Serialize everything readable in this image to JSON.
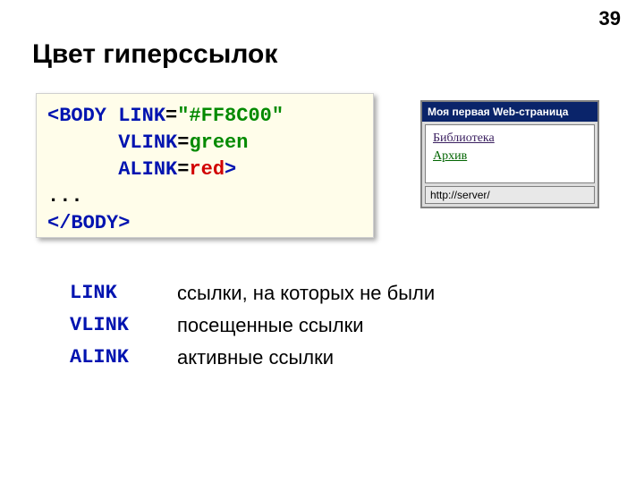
{
  "page_number": "39",
  "title": "Цвет гиперссылок",
  "code": {
    "tag_open": "<BODY",
    "attr_link": " LINK",
    "eq1": "=",
    "val_link": "\"#FF8C00\"",
    "indent": "      ",
    "attr_vlink": "VLINK",
    "eq2": "=",
    "val_vlink": "green",
    "attr_alink": "ALINK",
    "eq3": "=",
    "val_alink": "red",
    "close_angle": ">",
    "dots": "...",
    "tag_close": "</BODY>"
  },
  "browser": {
    "title": "Моя первая Web-страница",
    "link1": "Библиотека",
    "link2": "Архив",
    "status": "http://server/"
  },
  "defs": {
    "t1": "LINK",
    "d1": "ссылки, на которых не были",
    "t2": "VLINK",
    "d2": "посещенные ссылки",
    "t3": "ALINK",
    "d3": "активные ссылки"
  }
}
